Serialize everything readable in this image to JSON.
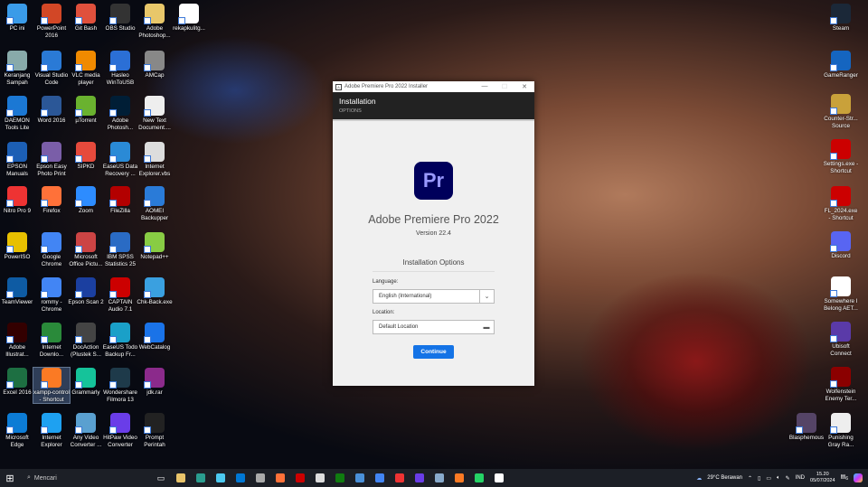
{
  "desktop_left": [
    [
      "PC ini",
      "PowerPoint 2016",
      "Git Bash",
      "OBS Studio",
      "Adobe Photoshop...",
      "rekapkulitg..."
    ],
    [
      "Keranjang Sampah",
      "Visual Studio Code",
      "VLC media player",
      "Hasleo WinToUSB",
      "AMCap"
    ],
    [
      "DAEMON Tools Lite",
      "Word 2016",
      "µTorrent",
      "Adobe Photosh...",
      "New Text Document...."
    ],
    [
      "EPSON Manuals",
      "Epson Easy Photo Print",
      "SIPKD",
      "EaseUS Data Recovery ...",
      "Internet Explorer.vbs"
    ],
    [
      "Nitro Pro 9",
      "Firefox",
      "Zoom",
      "FileZilla",
      "AOMEI Backupper"
    ],
    [
      "PowerISO",
      "Google Chrome",
      "Microsoft Office Pictu...",
      "IBM SPSS Statistics 25",
      "Notepad++"
    ],
    [
      "TeamViewer",
      "rommy - Chrome",
      "Epson Scan 2",
      "CAPTAIN Audio 7.1",
      "Chk-Back.exe"
    ],
    [
      "Adobe Illustrat...",
      "Internet Downlo...",
      "DocAction (Plustek S...",
      "EaseUS Todo Backup Fr...",
      "WebCatalog"
    ],
    [
      "Excel 2016",
      "xampp-control - Shortcut",
      "Grammarly",
      "Wondershare Filmora 13",
      "jdk.rar"
    ],
    [
      "Microsoft Edge",
      "Internet Explorer",
      "Any Video Converter ...",
      "HitPaw Video Converter",
      "Prompt Perintah"
    ]
  ],
  "desktop_colors": [
    [
      "#3a9be8",
      "#d24726",
      "#e0503c",
      "#333",
      "#e8c76a",
      "#fff"
    ],
    [
      "#8aa",
      "#2a7ad6",
      "#f08a00",
      "#2b6fd6",
      "#888"
    ],
    [
      "#1b78d4",
      "#2b5797",
      "#6ab22f",
      "#001e36",
      "#eee"
    ],
    [
      "#1c5fb5",
      "#7a5ea8",
      "#e64a3c",
      "#2a8ad6",
      "#ddd"
    ],
    [
      "#e33",
      "#ff7139",
      "#2d8cff",
      "#b30000",
      "#2a7bd8"
    ],
    [
      "#e8c000",
      "#4285f4",
      "#c44",
      "#2a6bc4",
      "#8c4"
    ],
    [
      "#0e5ba3",
      "#4285f4",
      "#1b3fa0",
      "#c00",
      "#3aa0e0"
    ],
    [
      "#330000",
      "#2a8a3a",
      "#444",
      "#1aa0c8",
      "#1a73e8"
    ],
    [
      "#1d6f42",
      "#fb7a24",
      "#15c39a",
      "#1e3a4a",
      "#8b2a8b"
    ],
    [
      "#0c7cd5",
      "#1ea1f1",
      "#5aa0d0",
      "#6a3de8",
      "#222"
    ]
  ],
  "desktop_right": [
    "Steam",
    "GameRanger",
    "Counter-Str... Source",
    "Settings.exe - Shortcut",
    "FL_2024.exe - Shortcut",
    "Discord",
    "Somewhere I Belong AET...",
    "Ubisoft Connect",
    "Wolfenstein Enemy Ter...",
    "Punishing Gray Ra..."
  ],
  "desktop_right_colors": [
    "#1b2838",
    "#1565c0",
    "#c9a13a",
    "#c00",
    "#c00",
    "#5865f2",
    "#fff",
    "#5a3aa8",
    "#8b0000",
    "#eee"
  ],
  "extra_icon": {
    "label": "Blasphemous",
    "color": "#554466"
  },
  "installer": {
    "window_title": "Adobe Premiere Pro 2022 Installer",
    "header_title": "Installation",
    "header_subtitle": "OPTIONS",
    "logo_text": "Pr",
    "product_name": "Adobe Premiere Pro 2022",
    "version": "Version 22.4",
    "section_title": "Installation Options",
    "language_label": "Language:",
    "language_value": "English (International)",
    "location_label": "Location:",
    "location_value": "Default Location",
    "continue_label": "Continue",
    "minimize": "—",
    "maximize": "☐",
    "close": "✕"
  },
  "taskbar": {
    "search_placeholder": "Mencari",
    "apps": [
      "#e9c46a",
      "#2a9d8f",
      "#4cc9f0",
      "#0078d4",
      "#aaa",
      "#ff7139",
      "#c00",
      "#ddd",
      "#107c10",
      "#4a90d9",
      "#4285f4",
      "#e33",
      "#6a3de8",
      "#8ac",
      "#fb7a24",
      "#25d366",
      "#fff"
    ],
    "weather": "29°C  Berawan",
    "lang": "IND",
    "time": "15.20",
    "date": "05/07/2024",
    "notif_count": "6"
  }
}
